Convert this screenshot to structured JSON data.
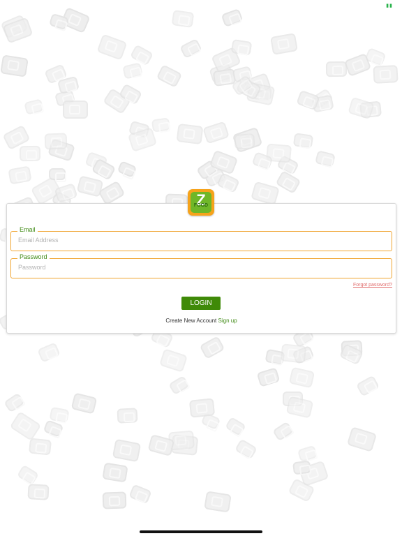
{
  "status_bar": {
    "battery_label": "▮▮"
  },
  "login": {
    "logo_letter": "Z",
    "logo_word": "FOOD",
    "email": {
      "label": "Email",
      "placeholder": "Email Address",
      "value": ""
    },
    "password": {
      "label": "Password",
      "placeholder": "Password",
      "value": ""
    },
    "forgot_password": "Forgot password?",
    "login_button": "LOGIN",
    "create_account_text": "Create New Account",
    "sign_up_link": "Sign up"
  },
  "colors": {
    "accent_green": "#3f8a08",
    "field_border_orange": "#f0a531",
    "forgot_link_red": "#e06b6b",
    "logo_orange": "#f6a31b",
    "logo_green": "#6fb728"
  },
  "icons": [
    "battery-icon",
    "app-logo-icon",
    "background-food-pattern"
  ]
}
